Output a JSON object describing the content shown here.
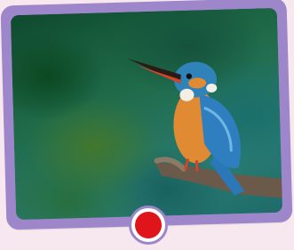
{
  "photo": {
    "subject": "kingfisher-on-branch"
  },
  "record_button": {
    "icon": "record-icon",
    "color": "#e0151c"
  },
  "frame": {
    "color": "#9d86c9",
    "background": "#f7e8ef"
  }
}
